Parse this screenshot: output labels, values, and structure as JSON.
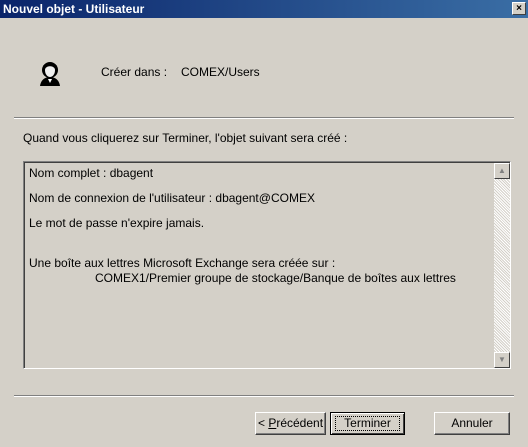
{
  "window": {
    "title": "Nouvel objet - Utilisateur",
    "close_glyph": "×"
  },
  "header": {
    "icon": "user-icon",
    "create_in_label": "Créer dans :",
    "create_in_path": "COMEX/Users"
  },
  "intro_text": "Quand vous cliquerez sur Terminer, l'objet suivant sera créé :",
  "summary": {
    "lines": [
      "Nom complet : dbagent",
      "Nom de connexion de l'utilisateur : dbagent@COMEX",
      "Le mot de passe n'expire jamais.",
      "Une boîte aux lettres Microsoft Exchange sera créée sur :",
      "COMEX1/Premier groupe de stockage/Banque de boîtes aux lettres"
    ]
  },
  "scrollbar": {
    "up_glyph": "▲",
    "down_glyph": "▼"
  },
  "buttons": {
    "previous_prefix": "< ",
    "previous_accel": "P",
    "previous_rest": "récédent",
    "finish": "Terminer",
    "cancel": "Annuler"
  }
}
